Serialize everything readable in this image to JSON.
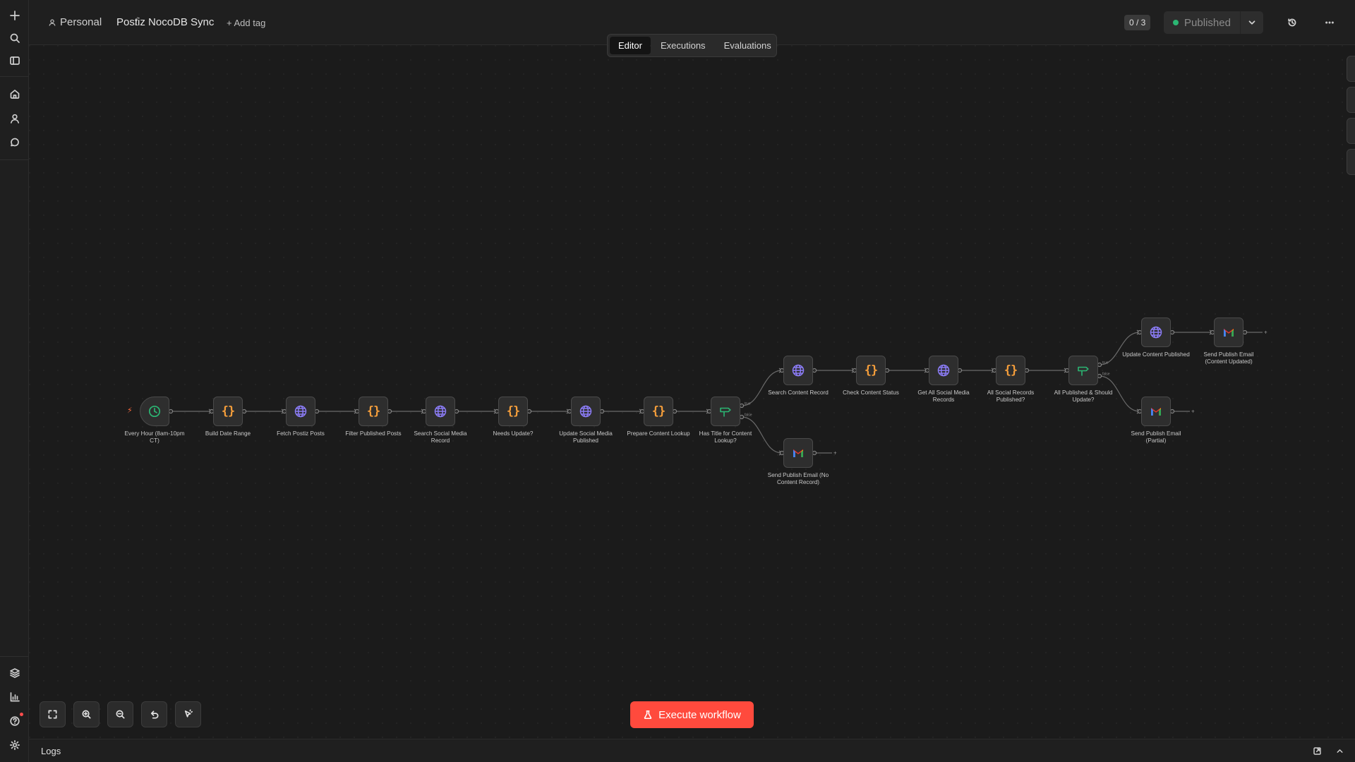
{
  "header": {
    "project": "Personal",
    "separator": "/",
    "workflow_title": "Postiz NocoDB Sync",
    "add_tag": "+ Add tag",
    "counter": "0 / 3",
    "publish_label": "Published"
  },
  "tabs": [
    {
      "label": "Editor",
      "active": true
    },
    {
      "label": "Executions",
      "active": false
    },
    {
      "label": "Evaluations",
      "active": false
    }
  ],
  "workflow": {
    "nodes": [
      {
        "id": "n1",
        "label": "Every Hour (8am-10pm CT)",
        "type": "schedule",
        "icon": "clock-icon"
      },
      {
        "id": "n2",
        "label": "Build Date Range",
        "type": "code",
        "icon": "code-braces-icon"
      },
      {
        "id": "n3",
        "label": "Fetch Postiz Posts",
        "type": "http",
        "icon": "globe-icon"
      },
      {
        "id": "n4",
        "label": "Filter Published Posts",
        "type": "code",
        "icon": "code-braces-icon"
      },
      {
        "id": "n5",
        "label": "Search Social Media Record",
        "type": "http",
        "icon": "globe-icon"
      },
      {
        "id": "n6",
        "label": "Needs Update?",
        "type": "code",
        "icon": "code-braces-icon"
      },
      {
        "id": "n7",
        "label": "Update Social Media Published",
        "type": "http",
        "icon": "globe-icon"
      },
      {
        "id": "n8",
        "label": "Prepare Content Lookup",
        "type": "code",
        "icon": "code-braces-icon"
      },
      {
        "id": "n9",
        "label": "Has Title for Content Lookup?",
        "type": "if",
        "icon": "signpost-icon"
      },
      {
        "id": "n10",
        "label": "Search Content Record",
        "type": "http",
        "icon": "globe-icon"
      },
      {
        "id": "n11",
        "label": "Check Content Status",
        "type": "code",
        "icon": "code-braces-icon"
      },
      {
        "id": "n12",
        "label": "Get All Social Media Records",
        "type": "http",
        "icon": "globe-icon"
      },
      {
        "id": "n13",
        "label": "All Social Records Published?",
        "type": "code",
        "icon": "code-braces-icon"
      },
      {
        "id": "n14",
        "label": "All Published & Should Update?",
        "type": "if",
        "icon": "signpost-icon"
      },
      {
        "id": "n15",
        "label": "Update Content Published",
        "type": "http",
        "icon": "globe-icon"
      },
      {
        "id": "n16",
        "label": "Send Publish Email (Content Updated)",
        "type": "gmail",
        "icon": "gmail-icon"
      },
      {
        "id": "n17",
        "label": "Send Publish Email (Partial)",
        "type": "gmail",
        "icon": "gmail-icon"
      },
      {
        "id": "n18",
        "label": "Send Publish Email (No Content Record)",
        "type": "gmail",
        "icon": "gmail-icon"
      }
    ],
    "branch_true": "true",
    "branch_false": "false",
    "add_output_symbol": "+"
  },
  "canvas_tools": {
    "right": [
      "plus-icon",
      "search-icon",
      "sticky-note-icon",
      "panel-icon"
    ],
    "bottom": [
      "fit-view-icon",
      "zoom-in-icon",
      "zoom-out-icon",
      "undo-icon",
      "cursor-icon"
    ]
  },
  "execute_label": "Execute workflow",
  "logs_label": "Logs",
  "colors": {
    "accent": "#ff4a3d",
    "code": "#f59e3b",
    "http": "#8b7cf6",
    "schedule": "#2bb673",
    "published_dot": "#2bb673"
  }
}
